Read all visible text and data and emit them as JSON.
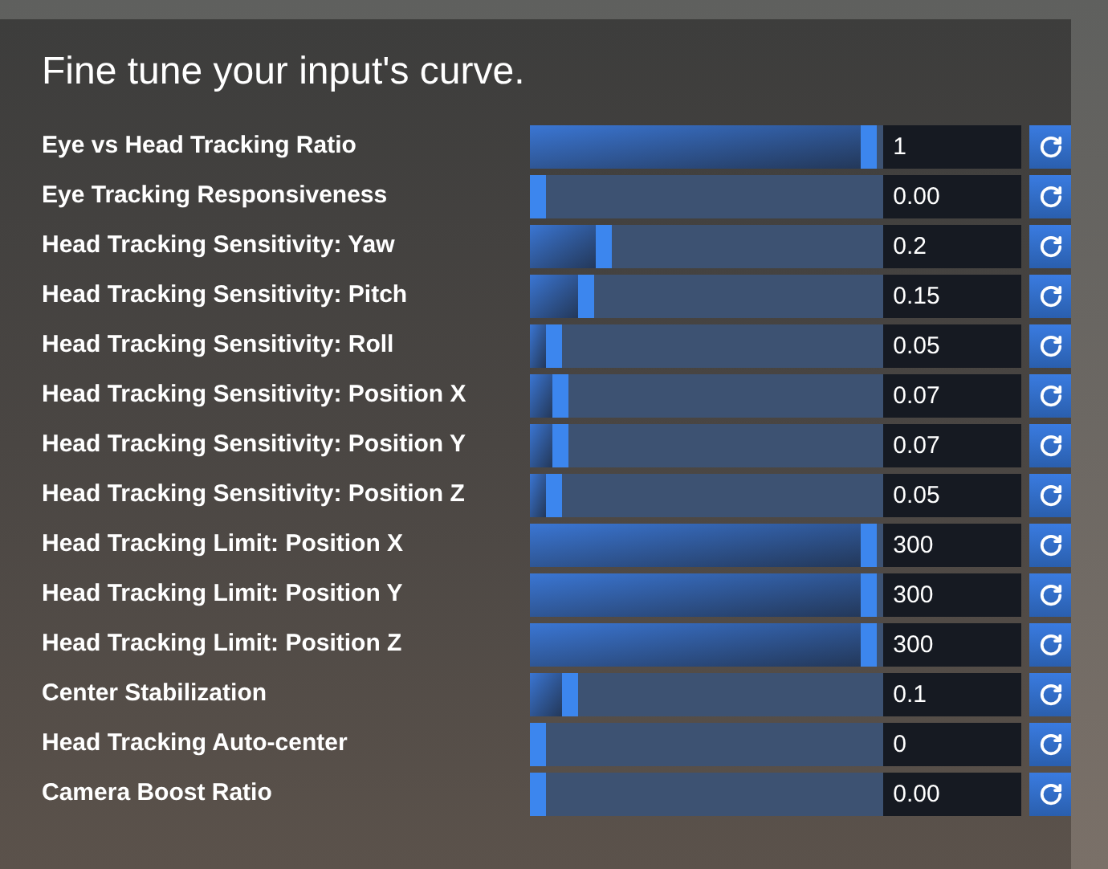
{
  "title": "Fine tune your input's curve.",
  "settings": [
    {
      "label": "Eye vs Head Tracking Ratio",
      "level": 1,
      "value": "1"
    },
    {
      "label": "Eye Tracking Responsiveness",
      "level": 0,
      "value": "0.00"
    },
    {
      "label": "Head Tracking Sensitivity: Yaw",
      "level": 0.2,
      "value": "0.2"
    },
    {
      "label": "Head Tracking Sensitivity: Pitch",
      "level": 0.15,
      "value": "0.15"
    },
    {
      "label": "Head Tracking Sensitivity: Roll",
      "level": 0.05,
      "value": "0.05"
    },
    {
      "label": "Head Tracking Sensitivity: Position X",
      "level": 0.07,
      "value": "0.07"
    },
    {
      "label": "Head Tracking Sensitivity: Position Y",
      "level": 0.07,
      "value": "0.07"
    },
    {
      "label": "Head Tracking Sensitivity: Position Z",
      "level": 0.05,
      "value": "0.05"
    },
    {
      "label": "Head Tracking Limit: Position X",
      "level": 1,
      "value": "300"
    },
    {
      "label": "Head Tracking Limit: Position Y",
      "level": 1,
      "value": "300"
    },
    {
      "label": "Head Tracking Limit: Position Z",
      "level": 1,
      "value": "300"
    },
    {
      "label": "Center Stabilization",
      "level": 0.1,
      "value": "0.1"
    },
    {
      "label": "Head Tracking Auto-center",
      "level": 0,
      "value": "0"
    },
    {
      "label": "Camera Boost Ratio",
      "level": 0,
      "value": "0.00"
    }
  ]
}
